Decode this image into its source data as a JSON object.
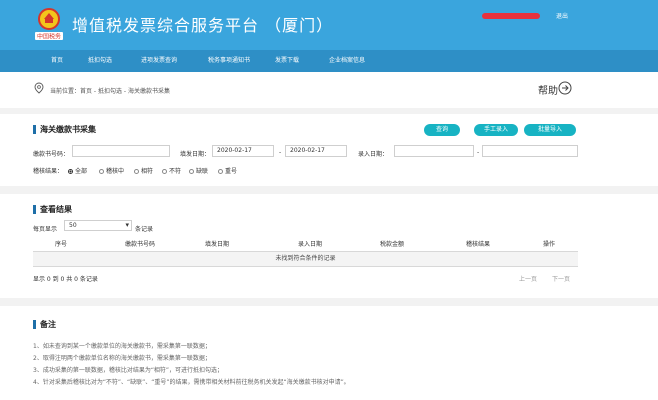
{
  "header": {
    "title": "增值税发票综合服务平台 （厦门）",
    "logo_text": "中国税务",
    "logout": "退出"
  },
  "nav": [
    "首页",
    "抵扣勾选",
    "进项发票查询",
    "税务事项通知书",
    "发票下载",
    "企业档案信息"
  ],
  "breadcrumb": "当前位置：首页 - 抵扣勾选 - 海关缴款书采集",
  "help": "帮助",
  "collect": {
    "title": "海关缴款书采集",
    "buttons": {
      "query": "查询",
      "manual": "手工录入",
      "batch": "批量导入"
    },
    "fields": {
      "cert_no_label": "缴款书号码：",
      "cert_no_value": "",
      "fill_date_label": "填发日期：",
      "fill_date_from": "2020-02-17",
      "fill_date_to": "2020-02-17",
      "entry_date_label": "录入日期：",
      "entry_date_from": "",
      "entry_date_to": "",
      "range_sep": "-"
    },
    "match_label": "稽核结果：",
    "match_options": [
      "全部",
      "稽核中",
      "相符",
      "不符",
      "缺联",
      "重号"
    ],
    "match_selected": "全部"
  },
  "results": {
    "title": "查看结果",
    "per_page_prefix": "每页显示",
    "per_page_value": "50",
    "per_page_suffix": "条记录",
    "columns": [
      "序号",
      "缴款书号码",
      "填发日期",
      "录入日期",
      "税款金额",
      "稽核结果",
      "操作"
    ],
    "empty_text": "未找到符合条件的记录",
    "summary": "显示 0 到 0 共 0 条记录",
    "prev": "上一页",
    "next": "下一页"
  },
  "notes": {
    "title": "备注",
    "items": [
      "1、如未查询到某一个缴款单位的海关缴款书，需采集第一联数据；",
      "2、取得注明两个缴款单位名称的海关缴款书，需采集第一联数据；",
      "3、成功采集的第一联数据，稽核比对结果为“相符”，可进行抵扣勾选；",
      "4、针对采集后稽核比对为“不符”、“缺联”、“重号”的结果，需携带相关材料前往税务机关发起“海关缴款书核对申请”。"
    ]
  },
  "colors": {
    "header": "#3aa5dd",
    "nav": "#2e8fc6",
    "button": "#17b3c3",
    "section_bar": "#1e6fa8"
  }
}
